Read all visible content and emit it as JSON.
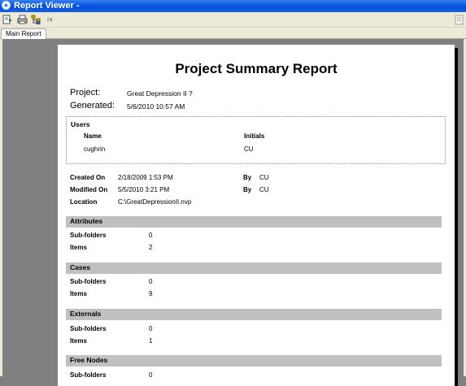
{
  "window": {
    "title": "Report Viewer -"
  },
  "toolbar": {
    "buttons": [
      "export-icon",
      "print-icon",
      "tree-icon",
      "first-page-icon"
    ]
  },
  "tab": {
    "label": "Main Report"
  },
  "report": {
    "title": "Project Summary Report",
    "project_label": "Project:",
    "project_value": "Great Depression II ?",
    "generated_label": "Generated:",
    "generated_value": "5/6/2010 10:57 AM",
    "users": {
      "title": "Users",
      "col_name": "Name",
      "col_initials": "Initials",
      "rows": [
        {
          "name": "cughrin",
          "initials": "CU"
        }
      ]
    },
    "meta": {
      "created_on_label": "Created On",
      "created_on_value": "2/18/2009 1:53 PM",
      "created_by_label": "By",
      "created_by_value": "CU",
      "modified_on_label": "Modified On",
      "modified_on_value": "5/5/2010 3:21 PM",
      "modified_by_label": "By",
      "modified_by_value": "CU",
      "location_label": "Location",
      "location_value": "C:\\GreatDepressionII.nvp"
    },
    "sections": [
      {
        "title": "Attributes",
        "rows": [
          {
            "label": "Sub-folders",
            "value": "0"
          },
          {
            "label": "Items",
            "value": "2"
          }
        ]
      },
      {
        "title": "Cases",
        "rows": [
          {
            "label": "Sub-folders",
            "value": "0"
          },
          {
            "label": "Items",
            "value": "9"
          }
        ]
      },
      {
        "title": "Externals",
        "rows": [
          {
            "label": "Sub-folders",
            "value": "0"
          },
          {
            "label": "Items",
            "value": "1"
          }
        ]
      },
      {
        "title": "Free Nodes",
        "rows": [
          {
            "label": "Sub-folders",
            "value": "0"
          }
        ]
      }
    ]
  }
}
